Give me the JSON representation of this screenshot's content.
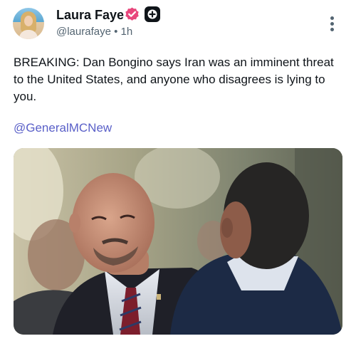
{
  "author": {
    "display_name": "Laura Faye",
    "handle": "@laurafaye",
    "separator": "•",
    "timestamp": "1h"
  },
  "colors": {
    "verified_badge": "#e8467c",
    "mention_link": "#5a60c8",
    "secondary_text": "#536471"
  },
  "tweet": {
    "text": "BREAKING: Dan Bongino says Iran was an imminent threat to the United States, and anyone who disagrees is lying to you.",
    "mention": "@GeneralMCNew"
  },
  "icons": {
    "verified": "verified-badge-icon",
    "plus": "plus-square-icon",
    "more": "more-vertical-icon"
  }
}
